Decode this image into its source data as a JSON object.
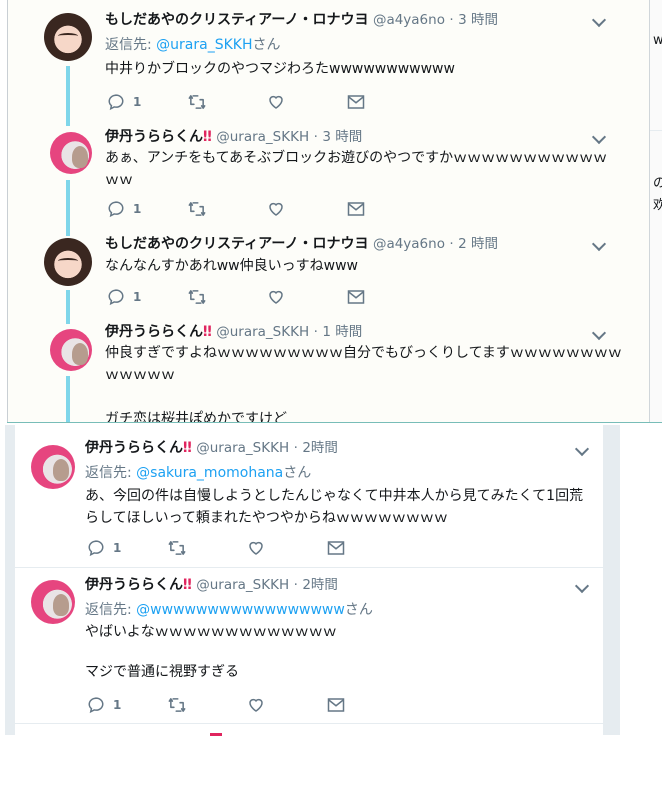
{
  "labels": {
    "reply_prefix": "返信先: ",
    "san": "さん",
    "dot": "·",
    "bang": "‼"
  },
  "colors": {
    "link": "#1da1f2",
    "meta": "#657786",
    "thread_line": "#7fd6ea",
    "emoji_bang": "#e0245e"
  },
  "side_fragments": [
    "ww",
    "のａ",
    "欢言"
  ],
  "top_tweets": [
    {
      "avatar_icon": "girl-photo-avatar",
      "name": "もしだあやのクリスティアーノ・ロナウヨ",
      "bang": "",
      "handle": "@a4ya6no",
      "time": "3 時間",
      "reply_to": "@urara_SKKH",
      "body": [
        "中井りかブロックのやつマジわろたwwwwwwwwwww"
      ],
      "reply_count": "1"
    },
    {
      "avatar_icon": "pink-background-avatar",
      "name": "伊丹うららくん",
      "bang": "‼",
      "handle": "@urara_SKKH",
      "time": "3 時間",
      "reply_to": "",
      "body": [
        "あぁ、アンチをもてあそぶブロックお遊びのやつですかｗｗｗｗｗｗｗｗｗｗｗ",
        "ｗｗ"
      ],
      "reply_count": "1"
    },
    {
      "avatar_icon": "girl-photo-avatar",
      "name": "もしだあやのクリスティアーノ・ロナウヨ",
      "bang": "",
      "handle": "@a4ya6no",
      "time": "2 時間",
      "reply_to": "",
      "body": [
        "なんなんすかあれww仲良いっすねwww"
      ],
      "reply_count": "1"
    },
    {
      "avatar_icon": "pink-background-avatar",
      "name": "伊丹うららくん",
      "bang": "‼",
      "handle": "@urara_SKKH",
      "time": "1 時間",
      "reply_to": "",
      "body": [
        "仲良すぎですよねｗｗｗｗｗｗｗｗｗ自分でもびっくりしてますｗｗｗｗｗｗｗｗ",
        "ｗｗｗｗｗ",
        "",
        "ガチ恋は桜井ぽめかですけど"
      ],
      "reply_count": ""
    }
  ],
  "bottom_tweets": [
    {
      "avatar_icon": "pink-background-avatar",
      "name": "伊丹うららくん",
      "bang": "‼",
      "handle": "@urara_SKKH",
      "time": "2時間",
      "reply_to": "@sakura_momohana",
      "body": [
        "あ、今回の件は自慢しようとしたんじゃなくて中井本人から見てみたくて1回荒",
        "らしてほしいって頼まれたやつやからねｗｗｗｗｗｗｗｗ"
      ],
      "reply_count": "1"
    },
    {
      "avatar_icon": "pink-background-avatar",
      "name": "伊丹うららくん",
      "bang": "‼",
      "handle": "@urara_SKKH",
      "time": "2時間",
      "reply_to": "@wwwwwwwwwwwwwwwww",
      "body": [
        "やばいよなｗｗｗｗｗｗｗｗｗｗｗｗｗ",
        "",
        "マジで普通に視野すぎる"
      ],
      "reply_count": "1"
    }
  ]
}
